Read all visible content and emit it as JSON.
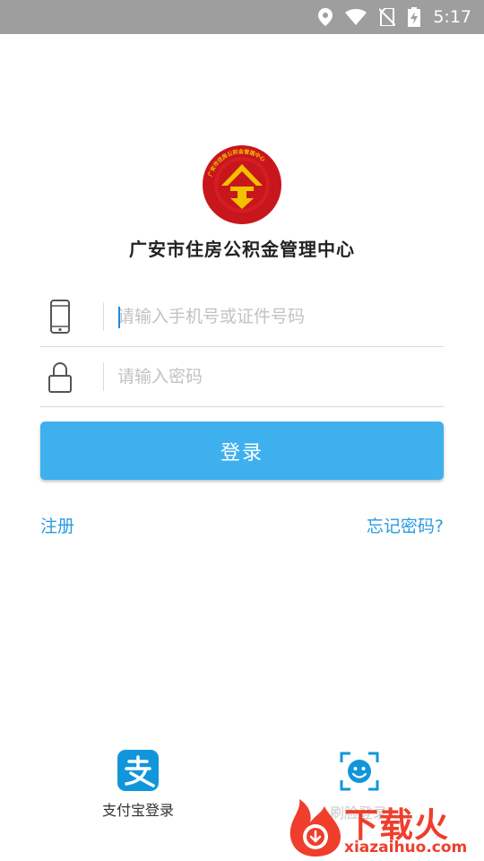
{
  "status_bar": {
    "time": "5:17",
    "icons": [
      "location-icon",
      "wifi-icon",
      "no-sim-icon",
      "battery-charging-icon"
    ]
  },
  "organization": {
    "title": "广安市住房公积金管理中心",
    "logo_text": "广安市住房公积金管理中心"
  },
  "form": {
    "phone_placeholder": "请输入手机号或证件号码",
    "password_placeholder": "请输入密码",
    "login_label": "登录"
  },
  "links": {
    "register": "注册",
    "forgot_password": "忘记密码?"
  },
  "bottom": {
    "alipay_label": "支付宝登录",
    "face_label": "刷脸登录"
  },
  "watermark": {
    "brand": "下载火",
    "domain": "xiazaihuo.com"
  },
  "colors": {
    "accent": "#3eb0ee",
    "link": "#2a9be0",
    "status_bar": "#9e9e9e",
    "logo_red": "#c8161d",
    "logo_gold": "#f2c200",
    "watermark": "#ef3e2c"
  }
}
